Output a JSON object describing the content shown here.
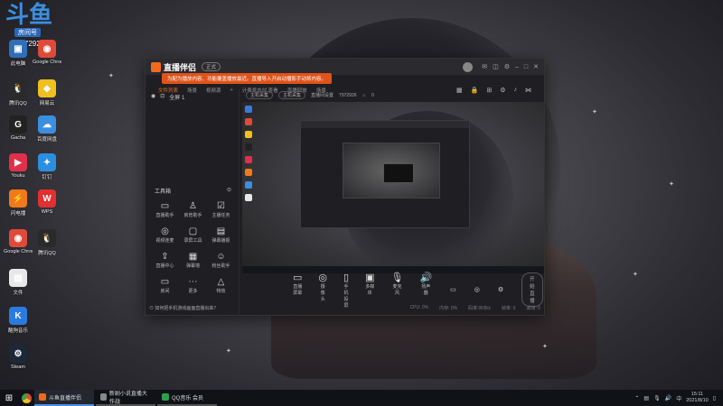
{
  "desktop": {
    "logo_text": "斗鱼",
    "logo_tag": "房间号",
    "room_id": "7972926",
    "icons": [
      {
        "label": "此电脑",
        "color": "#2f6fb8",
        "glyph": "▣"
      },
      {
        "label": "Google Chrome",
        "color": "#e04a3a",
        "glyph": "◉"
      },
      {
        "label": "腾讯QQ",
        "color": "#2a2a2a",
        "glyph": "🐧"
      },
      {
        "label": "网易云",
        "color": "#f0c020",
        "glyph": "◆"
      },
      {
        "label": "Gacha",
        "color": "#222",
        "glyph": "G"
      },
      {
        "label": "百度网盘",
        "color": "#3a8fe0",
        "glyph": "☁"
      },
      {
        "label": "Youku",
        "color": "#e0304a",
        "glyph": "▶"
      },
      {
        "label": "钉钉",
        "color": "#2a8fe0",
        "glyph": "✦"
      },
      {
        "label": "闪电播",
        "color": "#f07a1a",
        "glyph": "⚡"
      },
      {
        "label": "WPS",
        "color": "#e03030",
        "glyph": "W"
      },
      {
        "label": "Google Chrome",
        "color": "#e04a3a",
        "glyph": "◉"
      },
      {
        "label": "腾讯QQ",
        "color": "#2a2a2a",
        "glyph": "🐧"
      },
      {
        "label": "文件",
        "color": "#e8e8e8",
        "glyph": "▤"
      },
      {
        "label": "酷狗音乐",
        "color": "#2a7ae0",
        "glyph": "K"
      },
      {
        "label": "Steam",
        "color": "#1b2838",
        "glyph": "⚙"
      }
    ]
  },
  "app": {
    "title": "直播伴侣",
    "version": "正式",
    "notice": "为配为播放内容、功能覆盖播放最近。直播导入开启动播影手动将内容。",
    "tabs": [
      "文件列表",
      "场景",
      "视频源",
      "+",
      "计费号支付,查看",
      "直播回放",
      "场景"
    ],
    "left": {
      "scene_label": "全屏 1",
      "tools_title": "工具箱",
      "tools": [
        {
          "label": "直播助手",
          "glyph": "▭"
        },
        {
          "label": "房管助手",
          "glyph": "♙"
        },
        {
          "label": "主播任务",
          "glyph": "☑"
        },
        {
          "label": "视频连麦",
          "glyph": "◎"
        },
        {
          "label": "录屏工具",
          "glyph": "▢"
        },
        {
          "label": "弹幕播报",
          "glyph": "▤"
        },
        {
          "label": "直播中心",
          "glyph": "⇪"
        },
        {
          "label": "弹幕墙",
          "glyph": "▦"
        },
        {
          "label": "粉丝助手",
          "glyph": "☺"
        },
        {
          "label": "房间",
          "glyph": "▭"
        },
        {
          "label": "更多",
          "glyph": "⋯"
        },
        {
          "label": "特效",
          "glyph": "△"
        }
      ],
      "bottom_tip": "⊙ 如何把手机游戏画面直播出来？"
    },
    "subtabs": {
      "chip1": "主机采集",
      "chip2": "主机采集",
      "item3": "直播间设置",
      "room": "7972926",
      "count": "0"
    },
    "bottom_buttons": [
      {
        "label": "直播屏幕",
        "glyph": "▭"
      },
      {
        "label": "摄像头",
        "glyph": "◎"
      },
      {
        "label": "手机投屏",
        "glyph": "▯"
      },
      {
        "label": "多媒体",
        "glyph": "▣"
      },
      {
        "label": "麦克风",
        "glyph": "🎙"
      },
      {
        "label": "扬声器",
        "glyph": "🔊"
      }
    ],
    "start_label": "开始直播",
    "stats": [
      "CPU: 0%",
      "内存: 0%",
      "码率:0KB/s",
      "帧率: 0",
      "丢帧: 0"
    ]
  },
  "taskbar": {
    "buttons": [
      {
        "label": "斗鱼直播伴侣",
        "active": true
      },
      {
        "label": "新剧小说直播大作战",
        "active": false
      },
      {
        "label": "QQ音乐 会员",
        "active": false
      }
    ],
    "time": "15:11",
    "date": "2021/8/10"
  }
}
